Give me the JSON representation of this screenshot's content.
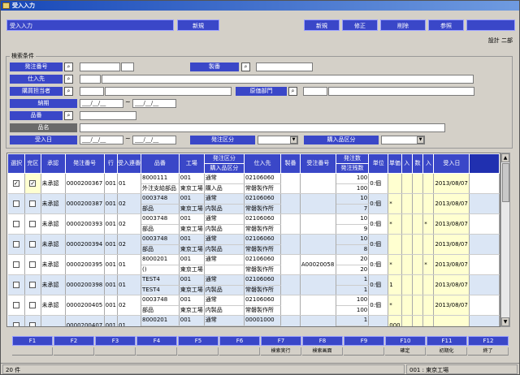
{
  "window": {
    "title": "受入入力"
  },
  "header": {
    "screen_name": "受入入力",
    "mode": "新規",
    "buttons": [
      "新規",
      "修正",
      "削除",
      "参照"
    ],
    "user": "設計 二部"
  },
  "search": {
    "legend": "検索条件",
    "labels": {
      "order_no": "発注番号",
      "vendor": "仕入先",
      "buyer": "購買担当者",
      "due": "納期",
      "item_no": "品番",
      "item_name": "品名",
      "recv_date": "受入日",
      "product_no": "製番",
      "cost_dept": "原価部門",
      "order_class": "発注区分",
      "recv_class": "購入品区分"
    },
    "date_placeholder": "___/__/__",
    "tilde": "~"
  },
  "grid": {
    "headers": [
      "選択",
      "完区",
      "承認",
      "発注番号",
      "行",
      "受入連番",
      "品番",
      "工場",
      "発注区分",
      "仕入先",
      "製番",
      "受注番号",
      "発注数",
      "単位",
      "",
      "",
      "",
      "",
      "受入日"
    ],
    "subheaders": {
      "order_class": "購入品区分",
      "qty": "発注残数",
      "h14": "単価",
      "h15": "入",
      "h16": "数",
      "h17": "入",
      "h18": "記番号"
    },
    "rows": [
      {
        "sel": "✓",
        "done": "✓",
        "appr": "未承認",
        "order": "0000200367",
        "line": "001",
        "seq": "01",
        "item": "8000111",
        "item2": "外注支給部品",
        "fac": "001",
        "fac2": "東京工場",
        "cls": "通常",
        "cls2": "購入品",
        "vend": "02106060",
        "vend2": "常磐製作所",
        "prod": "",
        "ord": "",
        "q1": "100",
        "q2": "100",
        "unit": "0:個",
        "f1": "",
        "f2": "",
        "mk": "00",
        "date": "2013/08/07"
      },
      {
        "sel": "",
        "done": "",
        "appr": "未承認",
        "order": "0000200387",
        "line": "001",
        "seq": "02",
        "item": "0003748",
        "item2": "部品",
        "fac": "001",
        "fac2": "東京工場",
        "cls": "通常",
        "cls2": "内製品",
        "vend": "02106060",
        "vend2": "常磐製作所",
        "prod": "",
        "ord": "",
        "q1": "10",
        "q2": "7",
        "unit": "0:個",
        "f1": "*",
        "f2": "",
        "mk": "00",
        "date": "2013/08/07"
      },
      {
        "sel": "",
        "done": "",
        "appr": "未承認",
        "order": "0000200393",
        "line": "001",
        "seq": "02",
        "item": "0003748",
        "item2": "部品",
        "fac": "001",
        "fac2": "東京工場",
        "cls": "通常",
        "cls2": "内製品",
        "vend": "02106060",
        "vend2": "常磐製作所",
        "prod": "",
        "ord": "",
        "q1": "10",
        "q2": "9",
        "unit": "0:個",
        "f1": "*",
        "f2": "*",
        "mk": "00",
        "date": "2013/08/07"
      },
      {
        "sel": "",
        "done": "",
        "appr": "未承認",
        "order": "0000200394",
        "line": "001",
        "seq": "02",
        "item": "0003748",
        "item2": "部品",
        "fac": "001",
        "fac2": "東京工場",
        "cls": "通常",
        "cls2": "内製品",
        "vend": "02106060",
        "vend2": "常磐製作所",
        "prod": "",
        "ord": "",
        "q1": "10",
        "q2": "8",
        "unit": "0:個",
        "f1": "",
        "f2": "",
        "mk": "00",
        "date": "2013/08/07"
      },
      {
        "sel": "",
        "done": "",
        "appr": "未承認",
        "order": "0000200395",
        "line": "001",
        "seq": "01",
        "item": "8000201",
        "item2": "()",
        "fac": "001",
        "fac2": "東京工場",
        "cls": "通常",
        "cls2": "",
        "vend": "02106060",
        "vend2": "常磐製作所",
        "prod": "",
        "ord": "A00020058",
        "q1": "20",
        "q2": "20",
        "unit": "0:個",
        "f1": "*",
        "f2": "*",
        "mk": "00",
        "date": "2013/08/07"
      },
      {
        "sel": "",
        "done": "",
        "appr": "未承認",
        "order": "0000200398",
        "line": "001",
        "seq": "01",
        "item": "TEST4",
        "item2": "TEST4",
        "fac": "001",
        "fac2": "東京工場",
        "cls": "通常",
        "cls2": "内製品",
        "vend": "02106060",
        "vend2": "常磐製作所",
        "prod": "",
        "ord": "",
        "q1": "1",
        "q2": "1",
        "unit": "0:個",
        "f1": "1",
        "f2": "",
        "mk": "00",
        "date": "2013/08/07"
      },
      {
        "sel": "",
        "done": "",
        "appr": "未承認",
        "order": "0000200405",
        "line": "001",
        "seq": "02",
        "item": "0003748",
        "item2": "部品",
        "fac": "001",
        "fac2": "東京工場",
        "cls": "通常",
        "cls2": "内製品",
        "vend": "02106060",
        "vend2": "常磐製作所",
        "prod": "",
        "ord": "",
        "q1": "100",
        "q2": "100",
        "unit": "0:個",
        "f1": "*",
        "f2": "",
        "mk": "00",
        "date": "2013/08/07"
      },
      {
        "sel": "",
        "done": "",
        "appr": "",
        "order": "0000200407",
        "line": "001",
        "seq": "01",
        "item": "8000201",
        "item2": "",
        "fac": "001",
        "fac2": "",
        "cls": "通常",
        "cls2": "",
        "vend": "00001000",
        "vend2": "",
        "prod": "",
        "ord": "",
        "q1": "1",
        "q2": "",
        "unit": "",
        "f1": "000",
        "f2": "",
        "mk": "",
        "date": ""
      }
    ]
  },
  "fkeys": [
    {
      "key": "F1",
      "label": ""
    },
    {
      "key": "F2",
      "label": ""
    },
    {
      "key": "F3",
      "label": ""
    },
    {
      "key": "F4",
      "label": ""
    },
    {
      "key": "F5",
      "label": ""
    },
    {
      "key": "F6",
      "label": ""
    },
    {
      "key": "F7",
      "label": "検索実行"
    },
    {
      "key": "F8",
      "label": "検索画面"
    },
    {
      "key": "F9",
      "label": ""
    },
    {
      "key": "F10",
      "label": "確定"
    },
    {
      "key": "F11",
      "label": "初期化"
    },
    {
      "key": "F12",
      "label": "終了"
    }
  ],
  "status": {
    "count": "20 件",
    "factory": "001 : 東京工場"
  },
  "colors": {
    "accent": "#3a47c8",
    "row_alt": "#dbe6f5",
    "highlight": "#ffffd0"
  }
}
